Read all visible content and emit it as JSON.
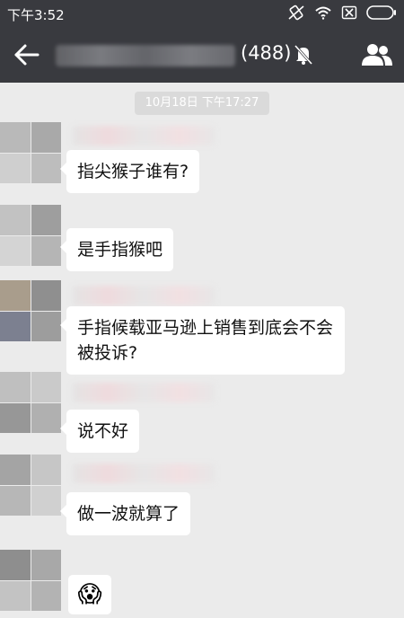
{
  "status": {
    "time": "下午3:52"
  },
  "header": {
    "count": "(488)"
  },
  "chat": {
    "timestamp": "10月18日 下午17:27",
    "messages": [
      {
        "text": "指尖猴子谁有?"
      },
      {
        "text": "是手指猴吧"
      },
      {
        "text": "手指候载亚马逊上销售到底会不会被投诉?"
      },
      {
        "text": "说不好"
      },
      {
        "text": "做一波就算了"
      },
      {
        "text": "😱"
      }
    ]
  }
}
